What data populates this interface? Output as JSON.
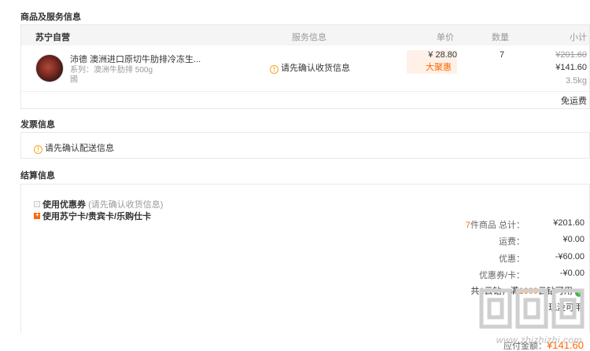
{
  "sections": {
    "goods_title": "商品及服务信息",
    "invoice_title": "发票信息",
    "settle_title": "结算信息"
  },
  "goods_table": {
    "shop_name": "苏宁自营",
    "headers": {
      "service": "服务信息",
      "price": "单价",
      "qty": "数量",
      "subtotal": "小计"
    },
    "item": {
      "name": "沛德 澳洲进口原切牛肋排冷冻生...",
      "spec": "系列：澳洲牛肋排 500g",
      "extra": "國",
      "service_msg": "请先确认收货信息",
      "price": "¥ 28.80",
      "promo": "大聚惠",
      "qty": "7",
      "subtotal_old": "¥201.60",
      "subtotal_new": "¥141.60",
      "weight": "3.5kg"
    },
    "freight": "免运费"
  },
  "invoice": {
    "msg": "请先确认配送信息"
  },
  "settlement": {
    "coupon_label": "使用优惠券",
    "coupon_hint": "(请先确认收货信息)",
    "card_label": "使用苏宁卡/贵宾卡/乐购仕卡",
    "total_count": "7",
    "total_label_suffix": "件商品 总计：",
    "total_value": "¥201.60",
    "freight_label": "运费：",
    "freight_value": "¥0.00",
    "discount_label": "优惠：",
    "discount_value": "-¥60.00",
    "coupon_card_label": "优惠券/卡：",
    "coupon_card_value": "-¥0.00",
    "cloud_text_a": "共",
    "cloud_count": "1",
    "cloud_text_b": "云钻，满",
    "cloud_min": "1000",
    "cloud_text_c": "云钻可用",
    "cloud_hint": "现没可用",
    "payable_label": "应付金额：",
    "payable_value": "¥141.60"
  },
  "watermark": {
    "url": "www.zhizhizhi.com"
  },
  "colors": {
    "accent": "#ff6600",
    "warn": "#f5a623",
    "border": "#e8e8e8"
  }
}
